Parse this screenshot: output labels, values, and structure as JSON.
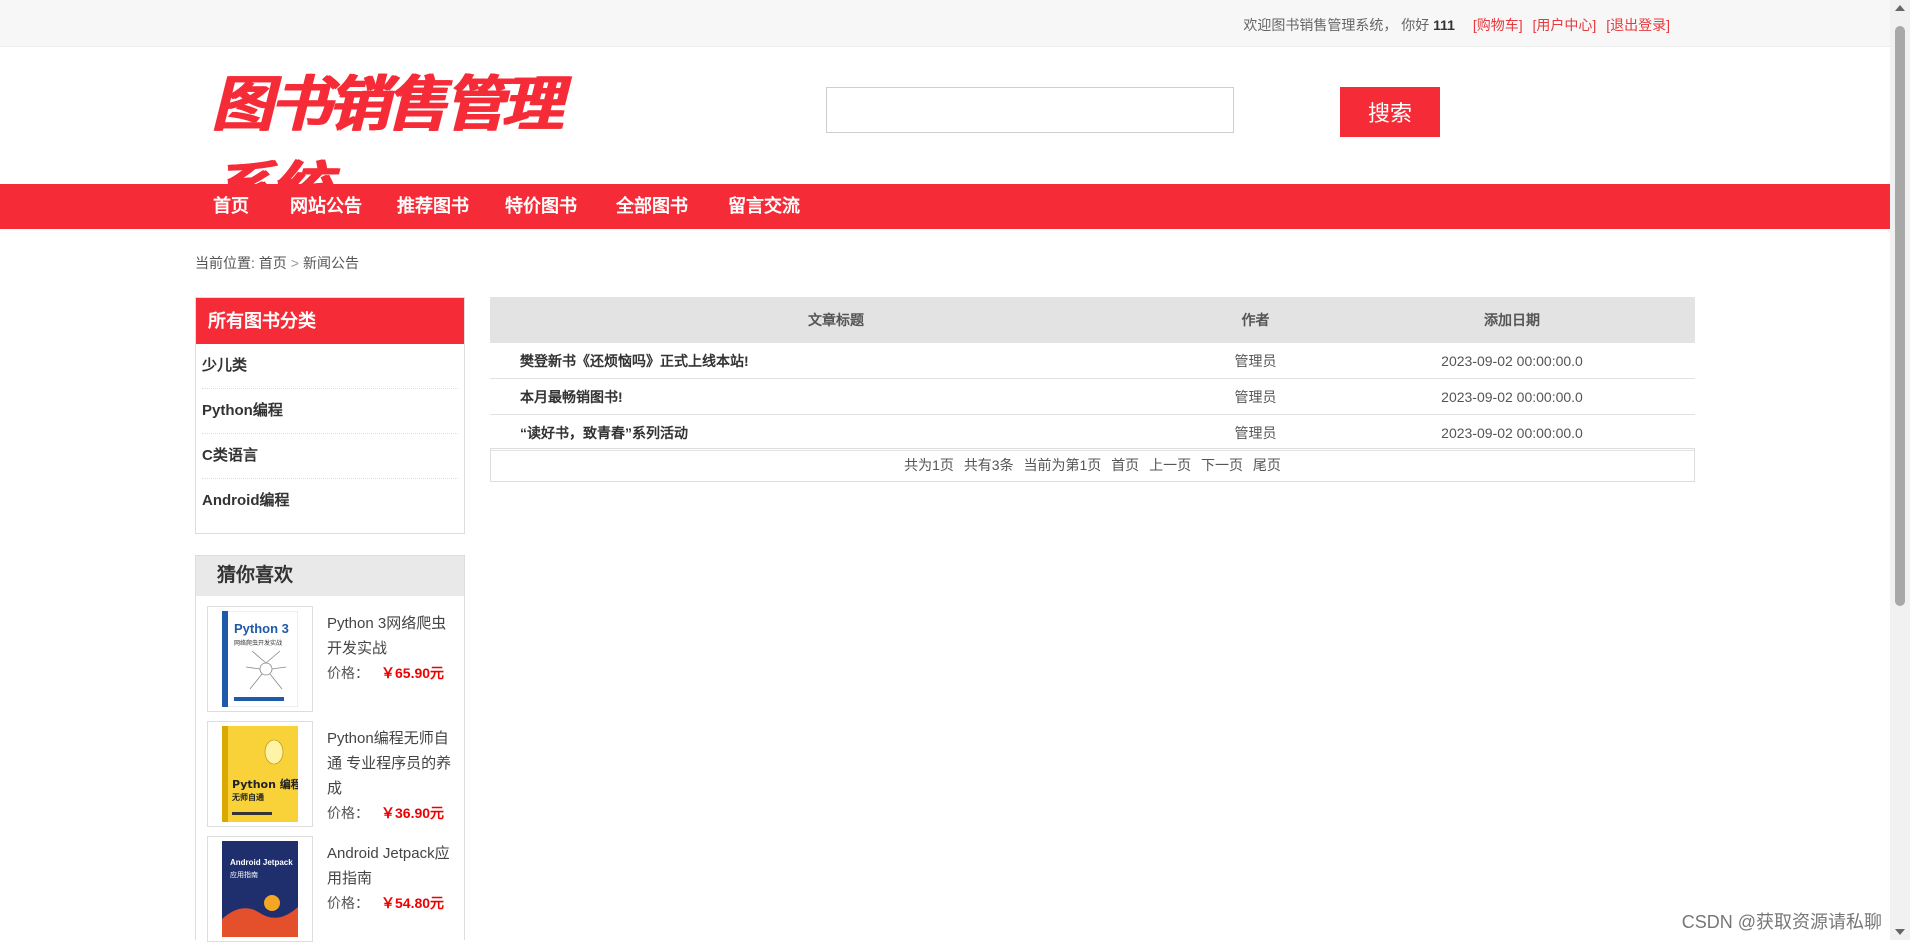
{
  "topbar": {
    "welcome": "欢迎图书销售管理系统，",
    "hello": "你好",
    "username": "111",
    "links": [
      "[购物车]",
      "[用户中心]",
      "[退出登录]"
    ]
  },
  "header": {
    "logo_text": "图书销售管理系统",
    "search_placeholder": "",
    "search_value": "",
    "search_button": "搜索"
  },
  "nav": [
    "首页",
    "网站公告",
    "推荐图书",
    "特价图书",
    "全部图书",
    "留言交流"
  ],
  "breadcrumb": {
    "prefix": "当前位置:",
    "home": "首页",
    "sep": ">",
    "current": "新闻公告"
  },
  "sidebar": {
    "categories_title": "所有图书分类",
    "categories": [
      "少儿类",
      "Python编程",
      "C类语言",
      "Android编程"
    ],
    "like_title": "猜你喜欢",
    "books": [
      {
        "name": "Python 3网络爬虫开发实战",
        "price_label": "价格：",
        "price": "￥65.90元",
        "cover_title": "Python 3",
        "cover_sub": "网络爬虫开发实战",
        "cover_color": "#ffffff"
      },
      {
        "name": "Python编程无师自通 专业程序员的养成",
        "price_label": "价格：",
        "price": "￥36.90元",
        "cover_title": "Python 编程",
        "cover_sub": "无师自通",
        "cover_color": "#f8d238"
      },
      {
        "name": "Android Jetpack应用指南",
        "price_label": "价格：",
        "price": "￥54.80元",
        "cover_title": "Android Jetpack",
        "cover_sub": "应用指南",
        "cover_color": "#1f2f6e"
      }
    ]
  },
  "news": {
    "columns": [
      "文章标题",
      "作者",
      "添加日期"
    ],
    "rows": [
      [
        "樊登新书《还烦恼吗》正式上线本站!",
        "管理员",
        "2023-09-02 00:00:00.0"
      ],
      [
        "本月最畅销图书!",
        "管理员",
        "2023-09-02 00:00:00.0"
      ],
      [
        "“读好书，致青春”系列活动",
        "管理员",
        "2023-09-02 00:00:00.0"
      ]
    ]
  },
  "pager": {
    "total_pages": "共为1页",
    "total_items": "共有3条",
    "current": "当前为第1页",
    "first": "首页",
    "prev": "上一页",
    "next": "下一页",
    "last": "尾页"
  },
  "watermark": "CSDN @获取资源请私聊",
  "colors": {
    "brand_red": "#f52c37",
    "price_red": "#ee0000"
  }
}
